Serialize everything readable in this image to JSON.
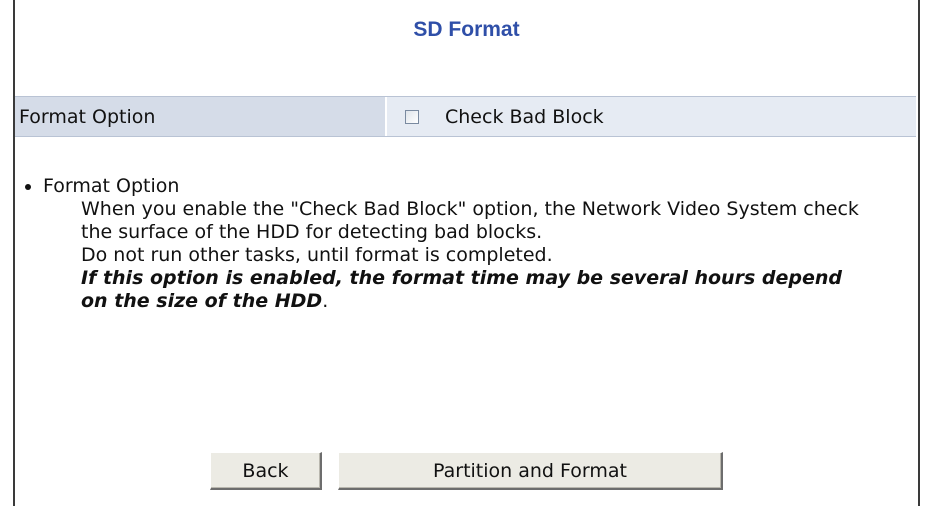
{
  "title": "SD Format",
  "option_row": {
    "label": "Format Option",
    "checkbox_label": "Check Bad Block",
    "checked": false
  },
  "help": {
    "heading": "Format Option",
    "line1": "When you enable the \"Check Bad Block\" option, the Network Video System check the surface of the HDD for detecting bad blocks.",
    "line2": "Do not run other tasks, until format is completed.",
    "warning": "If this option is enabled, the format time may be several hours depend on the size of the HDD",
    "warning_end": "."
  },
  "buttons": {
    "back": "Back",
    "partition_format": "Partition and Format"
  }
}
